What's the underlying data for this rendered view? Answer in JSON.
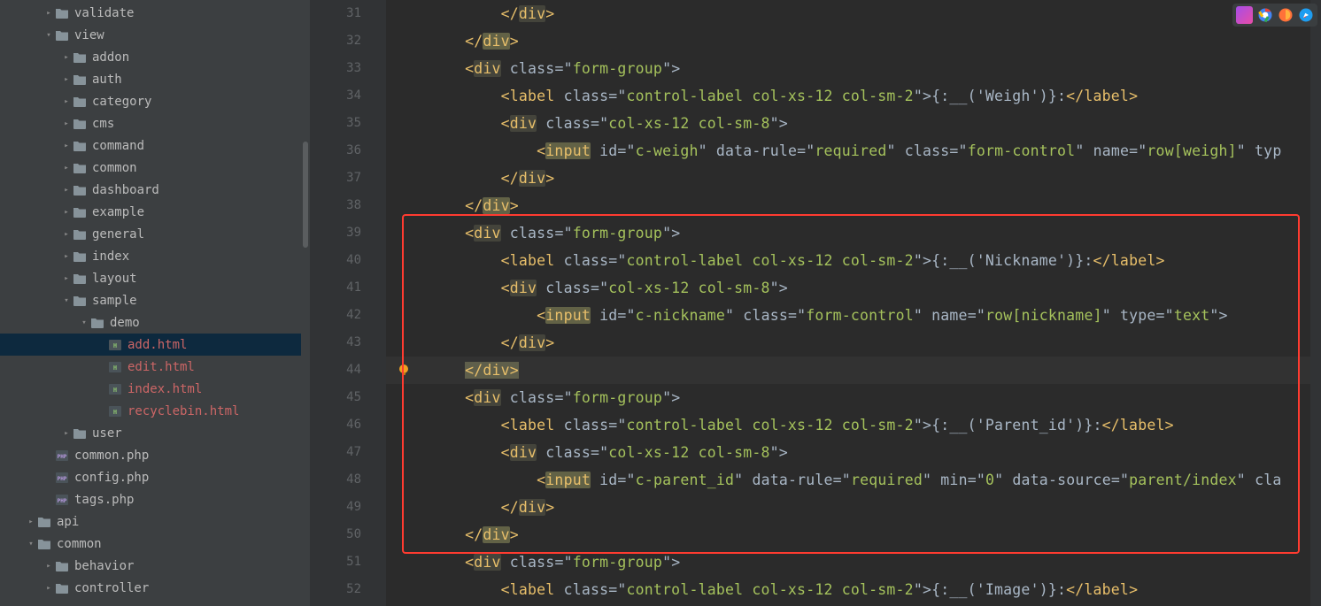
{
  "sidebar": {
    "items": [
      {
        "depth": 2,
        "chev": ">",
        "kind": "dir",
        "label": "validate"
      },
      {
        "depth": 2,
        "chev": "v",
        "kind": "dir",
        "label": "view"
      },
      {
        "depth": 3,
        "chev": ">",
        "kind": "dir",
        "label": "addon"
      },
      {
        "depth": 3,
        "chev": ">",
        "kind": "dir",
        "label": "auth"
      },
      {
        "depth": 3,
        "chev": ">",
        "kind": "dir",
        "label": "category"
      },
      {
        "depth": 3,
        "chev": ">",
        "kind": "dir",
        "label": "cms"
      },
      {
        "depth": 3,
        "chev": ">",
        "kind": "dir",
        "label": "command"
      },
      {
        "depth": 3,
        "chev": ">",
        "kind": "dir",
        "label": "common"
      },
      {
        "depth": 3,
        "chev": ">",
        "kind": "dir",
        "label": "dashboard"
      },
      {
        "depth": 3,
        "chev": ">",
        "kind": "dir",
        "label": "example"
      },
      {
        "depth": 3,
        "chev": ">",
        "kind": "dir",
        "label": "general"
      },
      {
        "depth": 3,
        "chev": ">",
        "kind": "dir",
        "label": "index"
      },
      {
        "depth": 3,
        "chev": ">",
        "kind": "dir",
        "label": "layout"
      },
      {
        "depth": 3,
        "chev": "v",
        "kind": "dir",
        "label": "sample"
      },
      {
        "depth": 4,
        "chev": "v",
        "kind": "dir",
        "label": "demo"
      },
      {
        "depth": 5,
        "chev": "",
        "kind": "html",
        "label": "add.html",
        "color": "red",
        "selected": true
      },
      {
        "depth": 5,
        "chev": "",
        "kind": "html",
        "label": "edit.html",
        "color": "red"
      },
      {
        "depth": 5,
        "chev": "",
        "kind": "html",
        "label": "index.html",
        "color": "red"
      },
      {
        "depth": 5,
        "chev": "",
        "kind": "html",
        "label": "recyclebin.html",
        "color": "red"
      },
      {
        "depth": 3,
        "chev": ">",
        "kind": "dir",
        "label": "user"
      },
      {
        "depth": 2,
        "chev": "",
        "kind": "php",
        "label": "common.php"
      },
      {
        "depth": 2,
        "chev": "",
        "kind": "php",
        "label": "config.php"
      },
      {
        "depth": 2,
        "chev": "",
        "kind": "php",
        "label": "tags.php"
      },
      {
        "depth": 1,
        "chev": ">",
        "kind": "dir",
        "label": "api"
      },
      {
        "depth": 1,
        "chev": "v",
        "kind": "dir",
        "label": "common"
      },
      {
        "depth": 2,
        "chev": ">",
        "kind": "dir",
        "label": "behavior"
      },
      {
        "depth": 2,
        "chev": ">",
        "kind": "dir",
        "label": "controller"
      }
    ]
  },
  "editor": {
    "startLine": 31,
    "bulbLine": 44,
    "redbox": {
      "startLine": 39,
      "endLine": 50
    },
    "lines": [
      {
        "n": 31,
        "i": 3,
        "seg": [
          {
            "t": "</",
            "k": "tag"
          },
          {
            "t": "div",
            "k": "tag",
            "hl": "box"
          },
          {
            "t": ">",
            "k": "tag"
          }
        ]
      },
      {
        "n": 32,
        "i": 2,
        "seg": [
          {
            "t": "</",
            "k": "tag"
          },
          {
            "t": "div",
            "k": "tag",
            "hl": "heavy"
          },
          {
            "t": ">",
            "k": "tag"
          }
        ]
      },
      {
        "n": 33,
        "i": 2,
        "seg": [
          {
            "t": "<",
            "k": "tag"
          },
          {
            "t": "div",
            "k": "tag",
            "hl": "box"
          },
          {
            "t": " ",
            "k": "p"
          },
          {
            "t": "class",
            "k": "attr"
          },
          {
            "t": "=\"",
            "k": "p"
          },
          {
            "t": "form-group",
            "k": "val"
          },
          {
            "t": "\">",
            "k": "p"
          }
        ]
      },
      {
        "n": 34,
        "i": 3,
        "seg": [
          {
            "t": "<",
            "k": "tag"
          },
          {
            "t": "label",
            "k": "tag"
          },
          {
            "t": " ",
            "k": "p"
          },
          {
            "t": "class",
            "k": "attr"
          },
          {
            "t": "=\"",
            "k": "p"
          },
          {
            "t": "control-label col-xs-12 col-sm-2",
            "k": "val"
          },
          {
            "t": "\">",
            "k": "p"
          },
          {
            "t": "{:__('Weigh')}:",
            "k": "text"
          },
          {
            "t": "</",
            "k": "tag"
          },
          {
            "t": "label",
            "k": "tag"
          },
          {
            "t": ">",
            "k": "tag"
          }
        ]
      },
      {
        "n": 35,
        "i": 3,
        "seg": [
          {
            "t": "<",
            "k": "tag"
          },
          {
            "t": "div",
            "k": "tag",
            "hl": "box"
          },
          {
            "t": " ",
            "k": "p"
          },
          {
            "t": "class",
            "k": "attr"
          },
          {
            "t": "=\"",
            "k": "p"
          },
          {
            "t": "col-xs-12 col-sm-8",
            "k": "val"
          },
          {
            "t": "\">",
            "k": "p"
          }
        ]
      },
      {
        "n": 36,
        "i": 4,
        "seg": [
          {
            "t": "<",
            "k": "tag"
          },
          {
            "t": "input",
            "k": "tag",
            "hl": "heavy"
          },
          {
            "t": " ",
            "k": "p"
          },
          {
            "t": "id",
            "k": "attr"
          },
          {
            "t": "=\"",
            "k": "p"
          },
          {
            "t": "c-weigh",
            "k": "val"
          },
          {
            "t": "\" ",
            "k": "p"
          },
          {
            "t": "data-rule",
            "k": "attr"
          },
          {
            "t": "=\"",
            "k": "p"
          },
          {
            "t": "required",
            "k": "val"
          },
          {
            "t": "\" ",
            "k": "p"
          },
          {
            "t": "class",
            "k": "attr"
          },
          {
            "t": "=\"",
            "k": "p"
          },
          {
            "t": "form-control",
            "k": "val"
          },
          {
            "t": "\" ",
            "k": "p"
          },
          {
            "t": "name",
            "k": "attr"
          },
          {
            "t": "=\"",
            "k": "p"
          },
          {
            "t": "row[weigh]",
            "k": "val"
          },
          {
            "t": "\" ",
            "k": "p"
          },
          {
            "t": "typ",
            "k": "attr"
          }
        ]
      },
      {
        "n": 37,
        "i": 3,
        "seg": [
          {
            "t": "</",
            "k": "tag"
          },
          {
            "t": "div",
            "k": "tag",
            "hl": "box"
          },
          {
            "t": ">",
            "k": "tag"
          }
        ]
      },
      {
        "n": 38,
        "i": 2,
        "seg": [
          {
            "t": "</",
            "k": "tag"
          },
          {
            "t": "div",
            "k": "tag",
            "hl": "heavy"
          },
          {
            "t": ">",
            "k": "tag"
          }
        ]
      },
      {
        "n": 39,
        "i": 2,
        "seg": [
          {
            "t": "<",
            "k": "tag"
          },
          {
            "t": "div",
            "k": "tag",
            "hl": "box"
          },
          {
            "t": " ",
            "k": "p"
          },
          {
            "t": "class",
            "k": "attr"
          },
          {
            "t": "=\"",
            "k": "p"
          },
          {
            "t": "form-group",
            "k": "val"
          },
          {
            "t": "\">",
            "k": "p"
          }
        ]
      },
      {
        "n": 40,
        "i": 3,
        "seg": [
          {
            "t": "<",
            "k": "tag"
          },
          {
            "t": "label",
            "k": "tag"
          },
          {
            "t": " ",
            "k": "p"
          },
          {
            "t": "class",
            "k": "attr"
          },
          {
            "t": "=\"",
            "k": "p"
          },
          {
            "t": "control-label col-xs-12 col-sm-2",
            "k": "val"
          },
          {
            "t": "\">",
            "k": "p"
          },
          {
            "t": "{:__('Nickname')}:",
            "k": "text"
          },
          {
            "t": "</",
            "k": "tag"
          },
          {
            "t": "label",
            "k": "tag"
          },
          {
            "t": ">",
            "k": "tag"
          }
        ]
      },
      {
        "n": 41,
        "i": 3,
        "seg": [
          {
            "t": "<",
            "k": "tag"
          },
          {
            "t": "div",
            "k": "tag",
            "hl": "box"
          },
          {
            "t": " ",
            "k": "p"
          },
          {
            "t": "class",
            "k": "attr"
          },
          {
            "t": "=\"",
            "k": "p"
          },
          {
            "t": "col-xs-12 col-sm-8",
            "k": "val"
          },
          {
            "t": "\">",
            "k": "p"
          }
        ]
      },
      {
        "n": 42,
        "i": 4,
        "seg": [
          {
            "t": "<",
            "k": "tag"
          },
          {
            "t": "input",
            "k": "tag",
            "hl": "heavy"
          },
          {
            "t": " ",
            "k": "p"
          },
          {
            "t": "id",
            "k": "attr"
          },
          {
            "t": "=\"",
            "k": "p"
          },
          {
            "t": "c-nickname",
            "k": "val"
          },
          {
            "t": "\" ",
            "k": "p"
          },
          {
            "t": "class",
            "k": "attr"
          },
          {
            "t": "=\"",
            "k": "p"
          },
          {
            "t": "form-control",
            "k": "val"
          },
          {
            "t": "\" ",
            "k": "p"
          },
          {
            "t": "name",
            "k": "attr"
          },
          {
            "t": "=\"",
            "k": "p"
          },
          {
            "t": "row[nickname]",
            "k": "val"
          },
          {
            "t": "\" ",
            "k": "p"
          },
          {
            "t": "type",
            "k": "attr"
          },
          {
            "t": "=\"",
            "k": "p"
          },
          {
            "t": "text",
            "k": "val"
          },
          {
            "t": "\">",
            "k": "p"
          }
        ]
      },
      {
        "n": 43,
        "i": 3,
        "seg": [
          {
            "t": "</",
            "k": "tag"
          },
          {
            "t": "div",
            "k": "tag",
            "hl": "box"
          },
          {
            "t": ">",
            "k": "tag"
          }
        ]
      },
      {
        "n": 44,
        "i": 2,
        "current": true,
        "seg": [
          {
            "t": "</",
            "k": "tag",
            "hl": "caret"
          },
          {
            "t": "div",
            "k": "tag",
            "hl": "caret"
          },
          {
            "t": ">",
            "k": "tag",
            "hl": "caret"
          }
        ]
      },
      {
        "n": 45,
        "i": 2,
        "seg": [
          {
            "t": "<",
            "k": "tag"
          },
          {
            "t": "div",
            "k": "tag",
            "hl": "box"
          },
          {
            "t": " ",
            "k": "p"
          },
          {
            "t": "class",
            "k": "attr"
          },
          {
            "t": "=\"",
            "k": "p"
          },
          {
            "t": "form-group",
            "k": "val"
          },
          {
            "t": "\">",
            "k": "p"
          }
        ]
      },
      {
        "n": 46,
        "i": 3,
        "seg": [
          {
            "t": "<",
            "k": "tag"
          },
          {
            "t": "label",
            "k": "tag"
          },
          {
            "t": " ",
            "k": "p"
          },
          {
            "t": "class",
            "k": "attr"
          },
          {
            "t": "=\"",
            "k": "p"
          },
          {
            "t": "control-label col-xs-12 col-sm-2",
            "k": "val"
          },
          {
            "t": "\">",
            "k": "p"
          },
          {
            "t": "{:__('Parent_id')}:",
            "k": "text"
          },
          {
            "t": "</",
            "k": "tag"
          },
          {
            "t": "label",
            "k": "tag"
          },
          {
            "t": ">",
            "k": "tag"
          }
        ]
      },
      {
        "n": 47,
        "i": 3,
        "seg": [
          {
            "t": "<",
            "k": "tag"
          },
          {
            "t": "div",
            "k": "tag",
            "hl": "box"
          },
          {
            "t": " ",
            "k": "p"
          },
          {
            "t": "class",
            "k": "attr"
          },
          {
            "t": "=\"",
            "k": "p"
          },
          {
            "t": "col-xs-12 col-sm-8",
            "k": "val"
          },
          {
            "t": "\">",
            "k": "p"
          }
        ]
      },
      {
        "n": 48,
        "i": 4,
        "seg": [
          {
            "t": "<",
            "k": "tag"
          },
          {
            "t": "input",
            "k": "tag",
            "hl": "heavy"
          },
          {
            "t": " ",
            "k": "p"
          },
          {
            "t": "id",
            "k": "attr"
          },
          {
            "t": "=\"",
            "k": "p"
          },
          {
            "t": "c-parent_id",
            "k": "val"
          },
          {
            "t": "\" ",
            "k": "p"
          },
          {
            "t": "data-rule",
            "k": "attr"
          },
          {
            "t": "=\"",
            "k": "p"
          },
          {
            "t": "required",
            "k": "val"
          },
          {
            "t": "\" ",
            "k": "p"
          },
          {
            "t": "min",
            "k": "attr"
          },
          {
            "t": "=\"",
            "k": "p"
          },
          {
            "t": "0",
            "k": "val"
          },
          {
            "t": "\" ",
            "k": "p"
          },
          {
            "t": "data-source",
            "k": "attr"
          },
          {
            "t": "=\"",
            "k": "p"
          },
          {
            "t": "parent/index",
            "k": "val"
          },
          {
            "t": "\" ",
            "k": "p"
          },
          {
            "t": "cla",
            "k": "attr"
          }
        ]
      },
      {
        "n": 49,
        "i": 3,
        "seg": [
          {
            "t": "</",
            "k": "tag"
          },
          {
            "t": "div",
            "k": "tag",
            "hl": "box"
          },
          {
            "t": ">",
            "k": "tag"
          }
        ]
      },
      {
        "n": 50,
        "i": 2,
        "seg": [
          {
            "t": "</",
            "k": "tag"
          },
          {
            "t": "div",
            "k": "tag",
            "hl": "heavy"
          },
          {
            "t": ">",
            "k": "tag"
          }
        ]
      },
      {
        "n": 51,
        "i": 2,
        "seg": [
          {
            "t": "<",
            "k": "tag"
          },
          {
            "t": "div",
            "k": "tag",
            "hl": "box"
          },
          {
            "t": " ",
            "k": "p"
          },
          {
            "t": "class",
            "k": "attr"
          },
          {
            "t": "=\"",
            "k": "p"
          },
          {
            "t": "form-group",
            "k": "val"
          },
          {
            "t": "\">",
            "k": "p"
          }
        ]
      },
      {
        "n": 52,
        "i": 3,
        "seg": [
          {
            "t": "<",
            "k": "tag"
          },
          {
            "t": "label",
            "k": "tag"
          },
          {
            "t": " ",
            "k": "p"
          },
          {
            "t": "class",
            "k": "attr"
          },
          {
            "t": "=\"",
            "k": "p"
          },
          {
            "t": "control-label col-xs-12 col-sm-2",
            "k": "val"
          },
          {
            "t": "\">",
            "k": "p"
          },
          {
            "t": "{:__('Image')}:",
            "k": "text"
          },
          {
            "t": "</",
            "k": "tag"
          },
          {
            "t": "label",
            "k": "tag"
          },
          {
            "t": ">",
            "k": "tag"
          }
        ]
      }
    ]
  },
  "toolbar": {
    "icons": [
      "phpstorm-icon",
      "chrome-icon",
      "firefox-icon",
      "safari-icon"
    ]
  }
}
